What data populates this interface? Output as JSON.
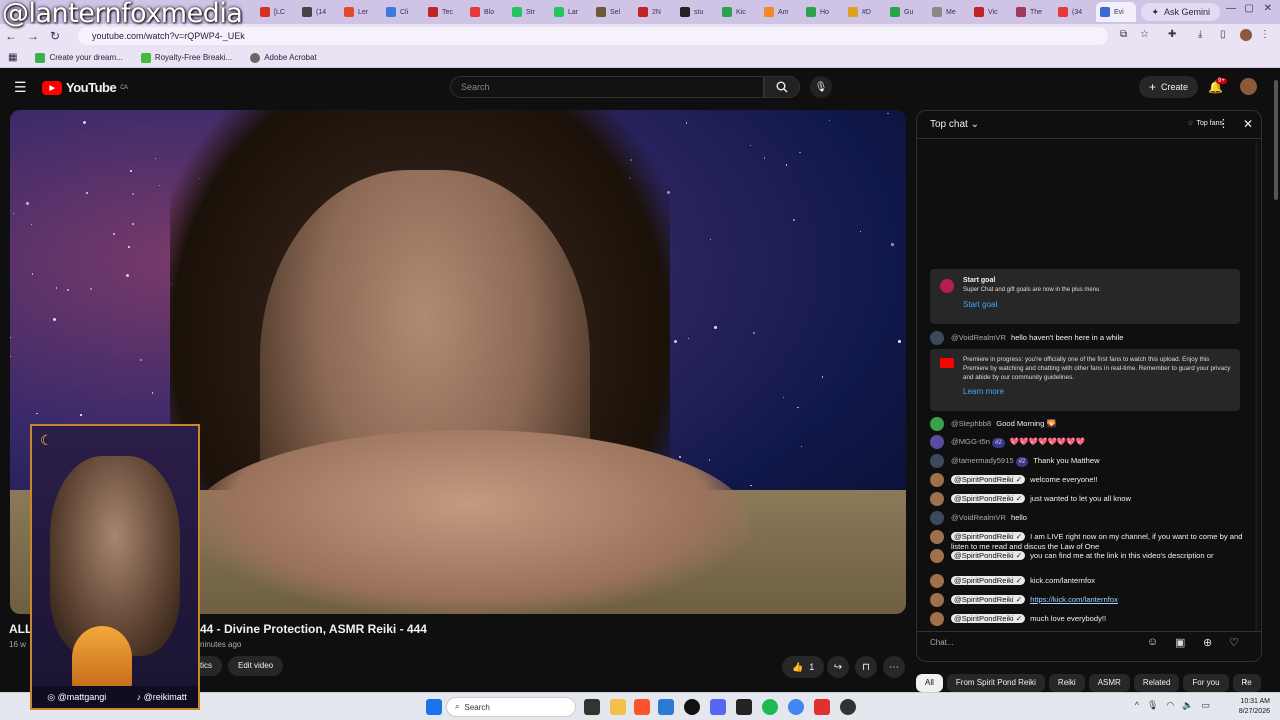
{
  "watermark": "@lanternfoxmedia",
  "browser": {
    "tabs": [
      "[LC",
      "(14",
      "Ler",
      "Cli",
      "Tec",
      "Blo",
      "Str",
      "Lar",
      "Sel",
      "2N",
      "stu",
      "Kic",
      "Am",
      "Ho",
      "#D",
      "Gu",
      "Me",
      "Vic",
      "The",
      "(34",
      "Evi"
    ],
    "ask_gemini": "Ask Gemini",
    "url": "youtube.com/watch?v=rQPWP4-_UEk",
    "bookmarks": [
      "Create your dream...",
      "Royalty-Free Breaki...",
      "Adobe Acrobat"
    ]
  },
  "youtube": {
    "logo": "YouTube",
    "region": "CA",
    "search_placeholder": "Search",
    "create_label": "Create",
    "notif_badge": "9+"
  },
  "video": {
    "title_left": "ALL",
    "title_right": "44 - Divine Protection, ASMR Reiki - 444",
    "meta_left": "16 w",
    "meta_right": "ninutes ago",
    "analytics_label": "tics",
    "edit_label": "Edit video",
    "like_count": "1",
    "overlay_instagram": "@mattgangi",
    "overlay_tiktok": "@reikimatt"
  },
  "chat": {
    "header": "Top chat",
    "top_fans": "Top fans",
    "goal": {
      "title": "Start goal",
      "subtitle": "Super Chat and gift goals are now in the plus menu",
      "link": "Start goal"
    },
    "premiere": {
      "text": "Premiere in progress: you're officially one of the first fans to watch this upload. Enjoy this Premiere by watching and chatting with other fans in real-time. Remember to guard your privacy and abide by our community guidelines.",
      "link": "Learn more"
    },
    "messages": [
      {
        "author": "@VoidRealmVR",
        "text": "hello haven't been here in a while",
        "badge": "",
        "owner": false,
        "avatar": "#3a4a5a"
      },
      {
        "author": "@Stephbb8",
        "text": "Good Morning 🌄",
        "badge": "",
        "owner": false,
        "avatar": "#3aa04a"
      },
      {
        "author": "@MGG-t5n",
        "text": "💖💖💖💖💖💖💖💖",
        "badge": "#2",
        "owner": false,
        "avatar": "#5a4aa0"
      },
      {
        "author": "@tamermady5915",
        "text": "Thank you Matthew",
        "badge": "#2",
        "owner": false,
        "avatar": "#3a4a5a"
      },
      {
        "author": "@SpiritPondReiki ✓",
        "text": "welcome everyone!!",
        "badge": "",
        "owner": true,
        "avatar": "#a0704a"
      },
      {
        "author": "@SpiritPondReiki ✓",
        "text": "just wanted to let you all know",
        "badge": "",
        "owner": true,
        "avatar": "#a0704a"
      },
      {
        "author": "@VoidRealmVR",
        "text": "hello",
        "badge": "",
        "owner": false,
        "avatar": "#3a4a5a"
      },
      {
        "author": "@SpiritPondReiki ✓",
        "text": "I am LIVE right now on my channel, if you want to come by and listen to me read and discus the Law of One",
        "badge": "",
        "owner": true,
        "avatar": "#a0704a"
      },
      {
        "author": "@SpiritPondReiki ✓",
        "text": "you can find me at the link in this video's description or",
        "badge": "",
        "owner": true,
        "avatar": "#a0704a"
      },
      {
        "author": "@SpiritPondReiki ✓",
        "text": "kick.com/lanternfox",
        "badge": "",
        "owner": true,
        "avatar": "#a0704a"
      },
      {
        "author": "@SpiritPondReiki ✓",
        "text": "https://kick.com/lanternfox",
        "badge": "",
        "owner": true,
        "avatar": "#a0704a",
        "link": true
      },
      {
        "author": "@SpiritPondReiki ✓",
        "text": "much love everybody!!",
        "badge": "",
        "owner": true,
        "avatar": "#a0704a"
      }
    ],
    "input_placeholder": "Chat..."
  },
  "chips": [
    "All",
    "From Spirit Pond Reiki",
    "Reiki",
    "ASMR",
    "Related",
    "For you",
    "Re"
  ],
  "taskbar": {
    "search": "Search",
    "time": "10:31 AM",
    "date": "8/27/2026"
  }
}
